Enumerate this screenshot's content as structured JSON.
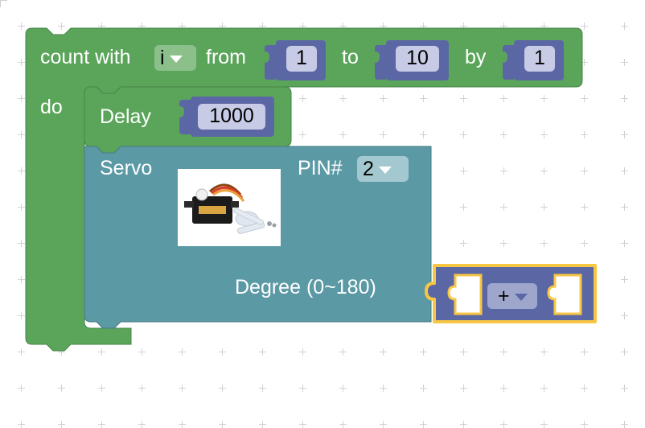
{
  "loop_block": {
    "prefix": "count with",
    "variable": "i",
    "from_label": "from",
    "from_value": "1",
    "to_label": "to",
    "to_value": "10",
    "by_label": "by",
    "by_value": "1",
    "do_label": "do",
    "color": "#5ba55b"
  },
  "delay_block": {
    "label": "Delay",
    "value": "1000",
    "color": "#5ba55b"
  },
  "servo_block": {
    "label": "Servo",
    "pin_label": "PIN#",
    "pin_value": "2",
    "image_icon": "servo-motor-photo",
    "degree_label": "Degree (0~180)",
    "color": "#5b99a5"
  },
  "math_block": {
    "operator": "+",
    "color": "#5b67a5",
    "selected_outline": "#f7c744"
  },
  "number_color": "#5b67a5"
}
